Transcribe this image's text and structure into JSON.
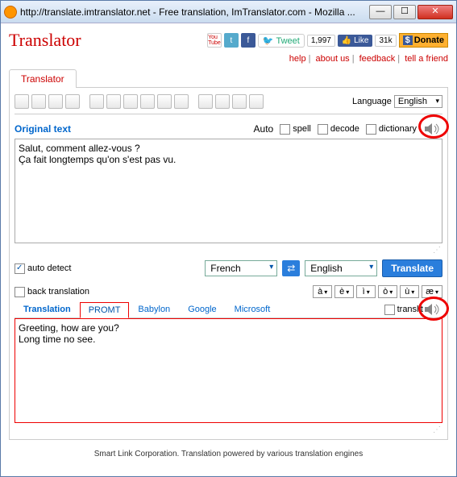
{
  "window": {
    "title": "http://translate.imtranslator.net - Free translation, ImTranslator.com - Mozilla ..."
  },
  "logo": "Translator",
  "social": {
    "tweet": "Tweet",
    "tweet_count": "1,997",
    "like": "Like",
    "like_count": "31k",
    "donate": "Donate"
  },
  "nav": {
    "help": "help",
    "about": "about us",
    "feedback": "feedback",
    "tell": "tell a friend"
  },
  "main_tab": "Translator",
  "toolbar": {
    "lang_label": "Language",
    "lang_value": "English"
  },
  "orig": {
    "label": "Original text",
    "auto": "Auto",
    "spell": "spell",
    "decode": "decode",
    "dictionary": "dictionary",
    "text": "Salut, comment allez-vous ?\nÇa fait longtemps qu'on s'est pas vu."
  },
  "mid": {
    "auto_detect": "auto detect",
    "back_trans": "back translation",
    "from": "French",
    "to": "English",
    "translate": "Translate",
    "accents": [
      "à",
      "è",
      "ì",
      "ò",
      "ù",
      "æ"
    ]
  },
  "trans": {
    "label": "Translation",
    "tabs": [
      "PROMT",
      "Babylon",
      "Google",
      "Microsoft"
    ],
    "translit": "translit",
    "text": "Greeting, how are you?\nLong time no see."
  },
  "footer": "Smart Link Corporation. Translation powered by various translation engines"
}
